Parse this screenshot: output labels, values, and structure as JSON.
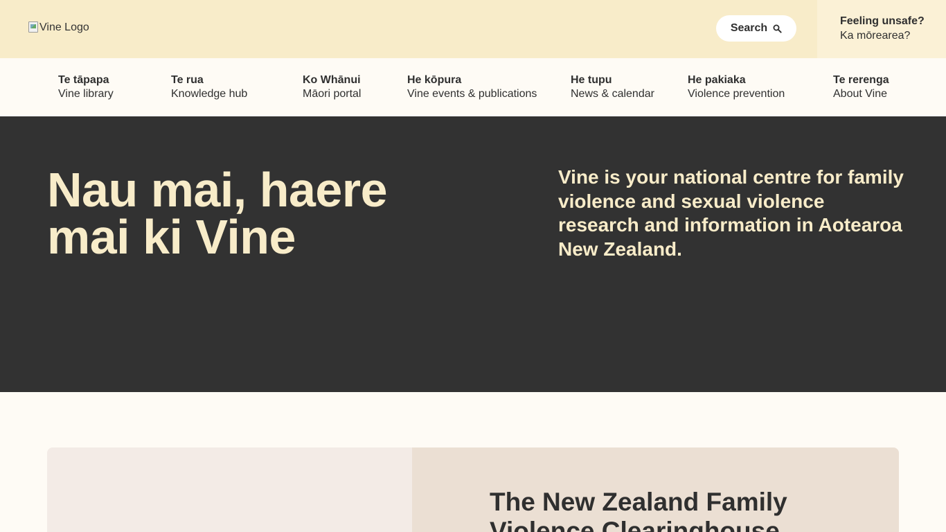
{
  "header": {
    "logo_alt": "Vine Logo",
    "search_label": "Search",
    "unsafe_title": "Feeling unsafe?",
    "unsafe_maori": "Ka mōrearea?",
    "background": "#f8ecc9"
  },
  "nav": {
    "items": [
      {
        "maori": "Te tāpapa",
        "english": "Vine library"
      },
      {
        "maori": "Te rua",
        "english": "Knowledge hub"
      },
      {
        "maori": "Ko Whānui",
        "english": "Māori portal"
      },
      {
        "maori": "He kōpura",
        "english": "Vine events & publications"
      },
      {
        "maori": "He tupu",
        "english": "News & calendar"
      },
      {
        "maori": "He pakiaka",
        "english": "Violence prevention"
      },
      {
        "maori": "Te rerenga",
        "english": "About Vine"
      }
    ]
  },
  "hero": {
    "title": "Nau mai, haere mai ki Vine",
    "lead": "Vine is your national centre for family violence and sexual violence research and information in Aotearoa New Zealand.",
    "background": "#323232",
    "text_color": "#f8ecc9"
  },
  "feature": {
    "title": "The New Zealand Family Violence Clearinghouse"
  }
}
